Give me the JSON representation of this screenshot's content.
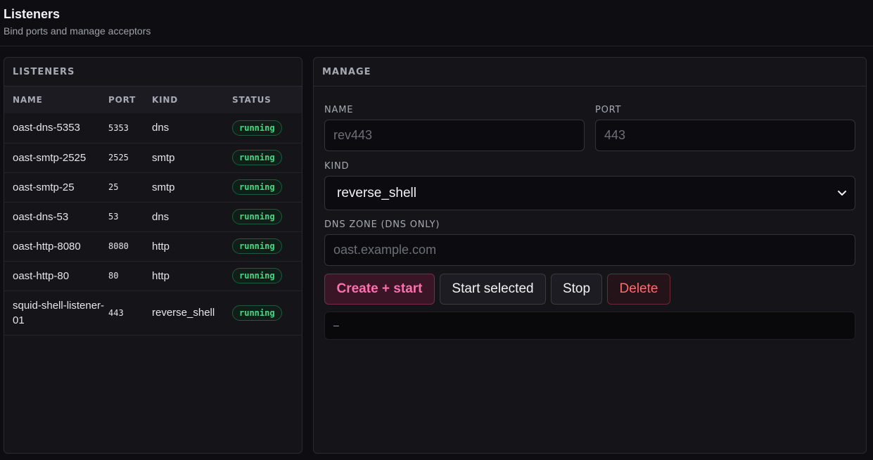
{
  "header": {
    "title": "Listeners",
    "subtitle": "Bind ports and manage acceptors"
  },
  "listeners_panel": {
    "title": "LISTENERS",
    "columns": [
      "NAME",
      "PORT",
      "KIND",
      "STATUS"
    ],
    "rows": [
      {
        "name": "oast-dns-5353",
        "port": "5353",
        "kind": "dns",
        "status": "running"
      },
      {
        "name": "oast-smtp-2525",
        "port": "2525",
        "kind": "smtp",
        "status": "running"
      },
      {
        "name": "oast-smtp-25",
        "port": "25",
        "kind": "smtp",
        "status": "running"
      },
      {
        "name": "oast-dns-53",
        "port": "53",
        "kind": "dns",
        "status": "running"
      },
      {
        "name": "oast-http-8080",
        "port": "8080",
        "kind": "http",
        "status": "running"
      },
      {
        "name": "oast-http-80",
        "port": "80",
        "kind": "http",
        "status": "running"
      },
      {
        "name": "squid-shell-listener-01",
        "port": "443",
        "kind": "reverse_shell",
        "status": "running"
      }
    ]
  },
  "manage_panel": {
    "title": "MANAGE",
    "name_label": "NAME",
    "name_placeholder": "rev443",
    "port_label": "PORT",
    "port_placeholder": "443",
    "kind_label": "KIND",
    "kind_selected": "reverse_shell",
    "dns_zone_label": "DNS ZONE (DNS ONLY)",
    "dns_zone_placeholder": "oast.example.com",
    "buttons": {
      "create": "Create + start",
      "start": "Start selected",
      "stop": "Stop",
      "delete": "Delete"
    },
    "output_text": "—"
  },
  "colors": {
    "accent_pink": "#ff6fb0",
    "running_green": "#3ddc84",
    "delete_red": "#ff6b6b",
    "background": "#0e0e12"
  }
}
